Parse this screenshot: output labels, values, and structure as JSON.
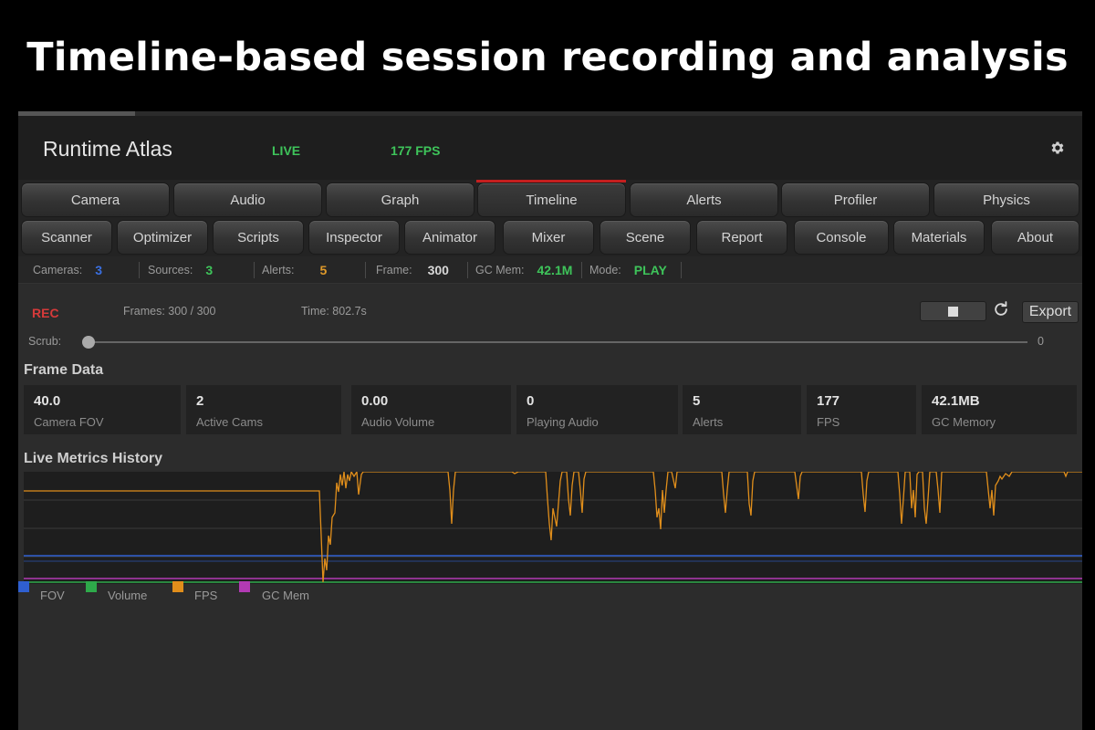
{
  "page": {
    "title": "Timeline-based session recording and analysis"
  },
  "header": {
    "app_title": "Runtime Atlas",
    "live": "LIVE",
    "fps": "177 FPS",
    "settings_icon": "gear-icon"
  },
  "tabs": {
    "row1": [
      "Camera",
      "Audio",
      "Graph",
      "Timeline",
      "Alerts",
      "Profiler",
      "Physics"
    ],
    "row2": [
      "Scanner",
      "Optimizer",
      "Scripts",
      "Inspector",
      "Animator",
      "Mixer",
      "Scene",
      "Report",
      "Console",
      "Materials",
      "About"
    ],
    "active": "Timeline"
  },
  "status": {
    "cameras_label": "Cameras:",
    "cameras_value": "3",
    "sources_label": "Sources:",
    "sources_value": "3",
    "alerts_label": "Alerts:",
    "alerts_value": "5",
    "frame_label": "Frame:",
    "frame_value": "300",
    "gc_label": "GC Mem:",
    "gc_value": "42.1M",
    "mode_label": "Mode:",
    "mode_value": "PLAY"
  },
  "recording": {
    "rec": "REC",
    "frames": "Frames: 300 / 300",
    "time": "Time: 802.7s",
    "export_label": "Export",
    "scrub_label": "Scrub:",
    "scrub_value": "0",
    "scrub_position": 0
  },
  "frame_data": {
    "title": "Frame Data",
    "cards": [
      {
        "value": "40.0",
        "label": "Camera FOV"
      },
      {
        "value": "2",
        "label": "Active Cams"
      },
      {
        "value": "0.00",
        "label": "Audio Volume"
      },
      {
        "value": "0",
        "label": "Playing Audio"
      },
      {
        "value": "5",
        "label": "Alerts"
      },
      {
        "value": "177",
        "label": "FPS"
      },
      {
        "value": "42.1MB",
        "label": "GC Memory"
      }
    ]
  },
  "metrics": {
    "title": "Live Metrics History",
    "legend": [
      {
        "name": "FOV",
        "color": "#2f5fd0"
      },
      {
        "name": "Volume",
        "color": "#2eaa4a"
      },
      {
        "name": "FPS",
        "color": "#e08e1b"
      },
      {
        "name": "GC Mem",
        "color": "#b23ab4"
      }
    ]
  },
  "colors": {
    "accent_red": "#c41f1f",
    "blue": "#3a6fe0",
    "green": "#3ec45a",
    "orange": "#e09a2a"
  }
}
